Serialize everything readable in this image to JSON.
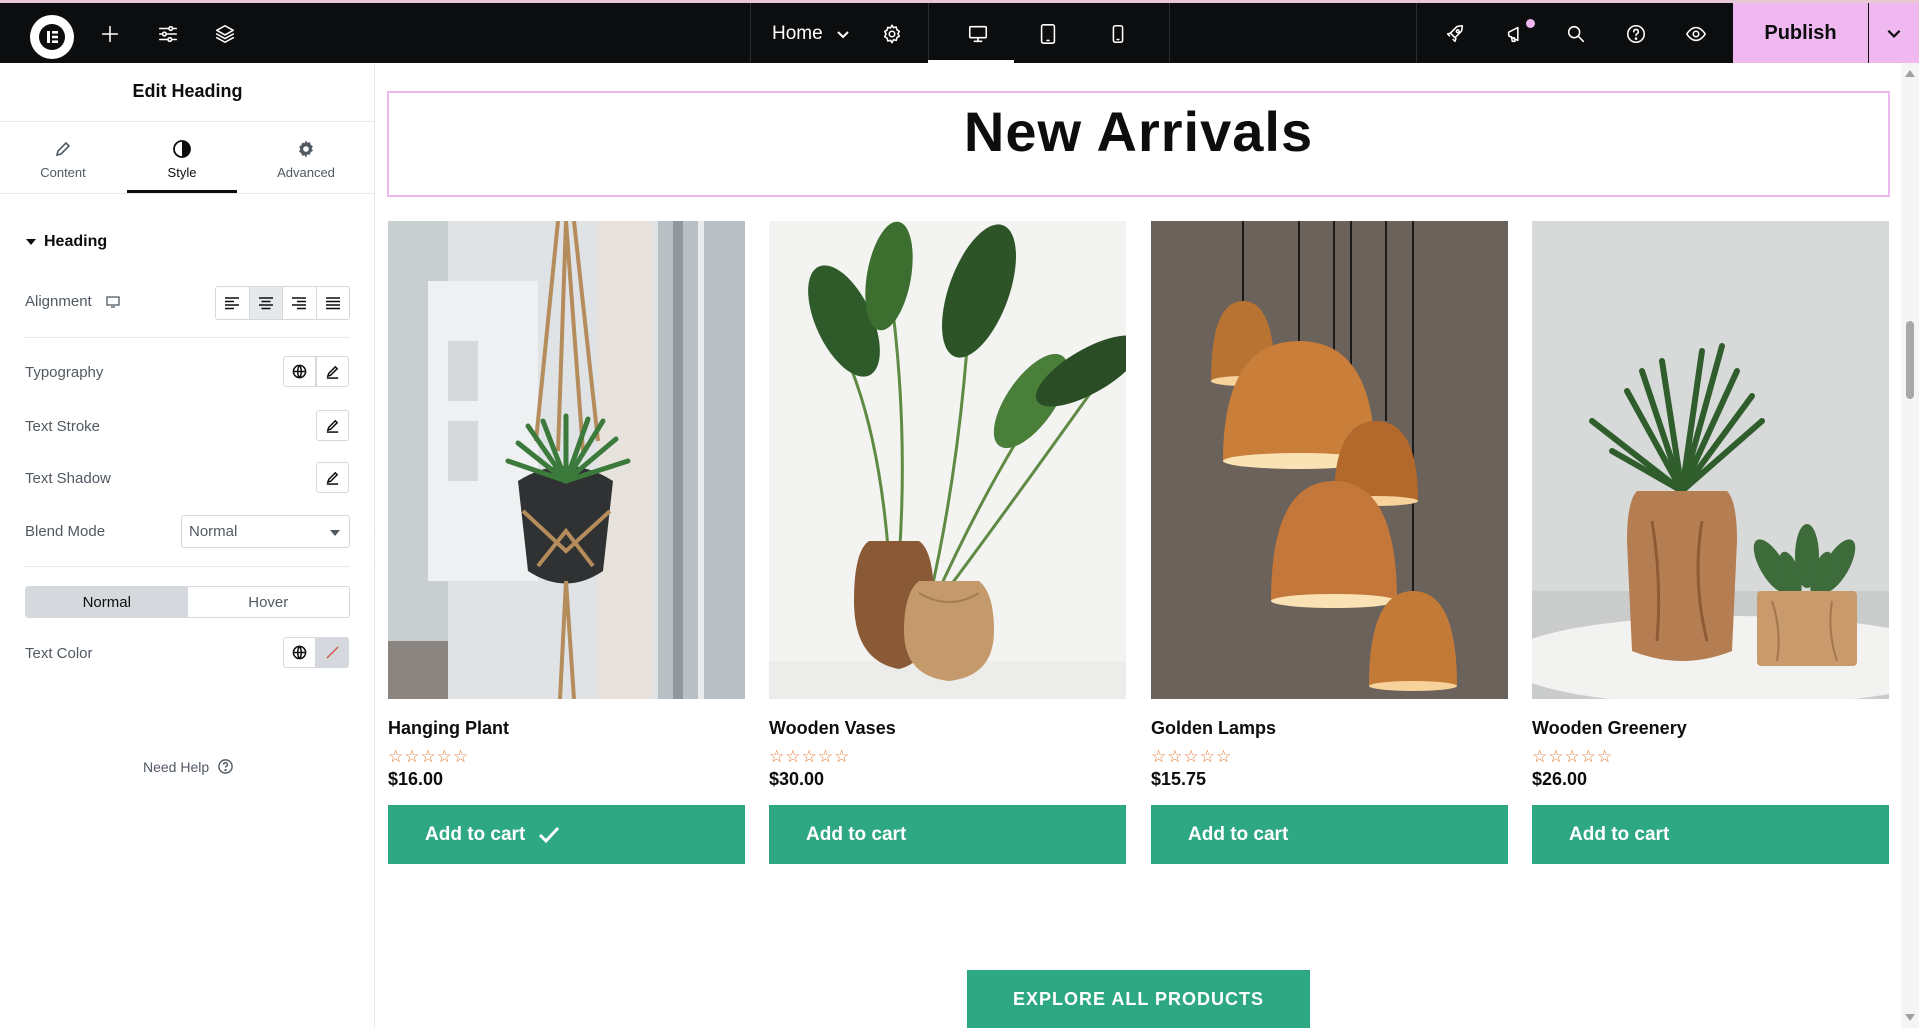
{
  "topbar": {
    "page_name": "Home",
    "publish_label": "Publish"
  },
  "panel": {
    "title": "Edit Heading",
    "tabs": [
      {
        "label": "Content"
      },
      {
        "label": "Style"
      },
      {
        "label": "Advanced"
      }
    ],
    "section": "Heading",
    "controls": {
      "alignment": "Alignment",
      "typography": "Typography",
      "text_stroke": "Text Stroke",
      "text_shadow": "Text Shadow",
      "blend_mode": "Blend Mode",
      "blend_mode_value": "Normal",
      "state_normal": "Normal",
      "state_hover": "Hover",
      "text_color": "Text Color"
    },
    "help": "Need Help"
  },
  "canvas": {
    "heading": "New Arrivals",
    "products": [
      {
        "name": "Hanging Plant",
        "price": "$16.00",
        "rating": 0,
        "cart": "Add to cart"
      },
      {
        "name": "Wooden Vases",
        "price": "$30.00",
        "rating": 0,
        "cart": "Add to cart"
      },
      {
        "name": "Golden Lamps",
        "price": "$15.75",
        "rating": 0,
        "cart": "Add to cart"
      },
      {
        "name": "Wooden Greenery",
        "price": "$26.00",
        "rating": 0,
        "cart": "Add to cart"
      }
    ],
    "stars": "☆☆☆☆☆",
    "explore": "EXPLORE ALL PRODUCTS"
  },
  "colors": {
    "accent_pink": "#f0b8f0",
    "button_green": "#2ea882",
    "topbar_bg": "#0c0d0e",
    "star_orange": "#e07b39"
  }
}
